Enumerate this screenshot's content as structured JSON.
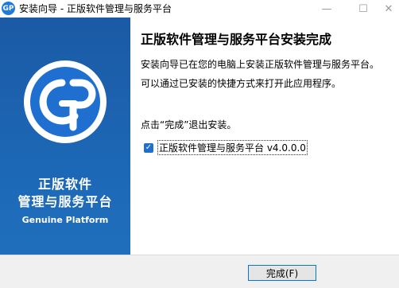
{
  "window": {
    "title": "安装向导 - 正版软件管理与服务平台",
    "app_icon_text": "GP",
    "minimize_glyph": "—",
    "maximize_glyph": "☐",
    "close_glyph": "✕"
  },
  "side_panel": {
    "logo_text": "GP",
    "name_line1": "正版软件",
    "name_line2": "管理与服务平台",
    "english_name": "Genuine Platform"
  },
  "content": {
    "heading": "正版软件管理与服务平台安装完成",
    "line1": "安装向导已在您的电脑上安装正版软件管理与服务平台。",
    "line2": "可以通过已安装的快捷方式来打开此应用程序。",
    "line3": "点击“完成”退出安装。",
    "checkbox_label": "正版软件管理与服务平台 v4.0.0.0",
    "checkbox_checked": true
  },
  "footer": {
    "finish_label": "完成(F)"
  },
  "colors": {
    "panel_blue": "#1c66b4",
    "accent": "#0078d7"
  }
}
